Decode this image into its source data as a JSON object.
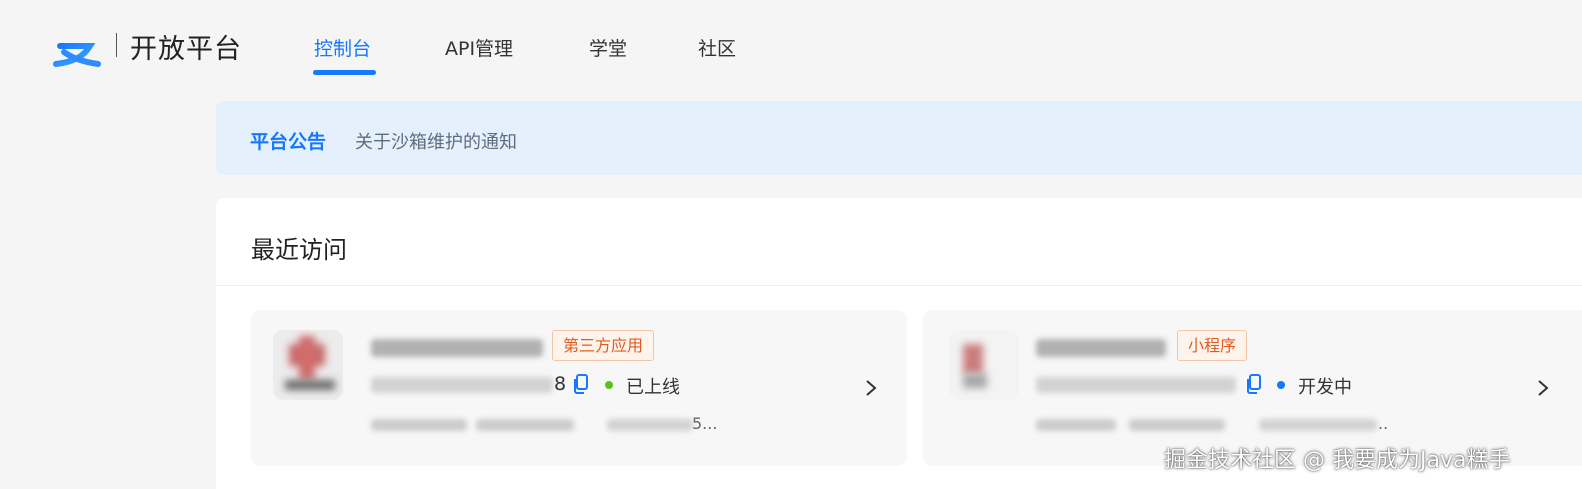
{
  "header": {
    "logo_icon": "alipay-logo-icon",
    "logo_text": "开放平台",
    "nav": [
      {
        "label": "控制台",
        "active": true
      },
      {
        "label": "API管理",
        "active": false
      },
      {
        "label": "学堂",
        "active": false
      },
      {
        "label": "社区",
        "active": false
      }
    ]
  },
  "announcement": {
    "title": "平台公告",
    "text": "关于沙箱维护的通知"
  },
  "recent": {
    "title": "最近访问",
    "cards": [
      {
        "type_tag": "第三方应用",
        "appid_tail": "8",
        "status": "已上线",
        "status_color": "#52c41a",
        "extra_tail": "5...",
        "icon": "copy-icon"
      },
      {
        "type_tag": "小程序",
        "appid_tail": "",
        "status": "开发中",
        "status_color": "#1677ff",
        "extra_tail": "..",
        "icon": "copy-icon"
      }
    ]
  },
  "colors": {
    "accent": "#1677ff",
    "tag_text": "#e15b1f",
    "announce_bg": "#e5f0fd"
  },
  "watermark": "掘金技术社区 @ 我要成为Java糕手"
}
